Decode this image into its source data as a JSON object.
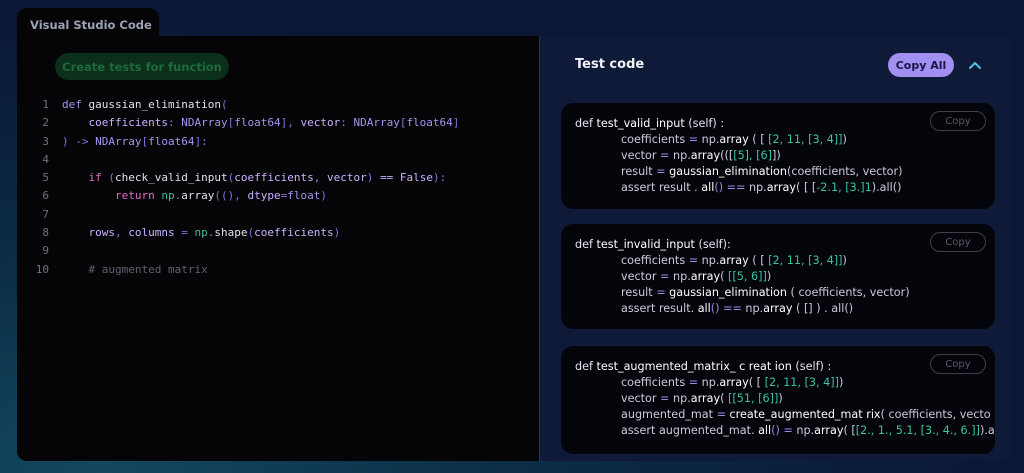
{
  "window": {
    "tab_title": "Visual Studio Code"
  },
  "editor": {
    "create_button_label": "Create tests for function",
    "line_numbers": [
      "1",
      "2",
      "3",
      "4",
      "5",
      "6",
      "7",
      "8",
      "9",
      "10"
    ],
    "code": {
      "l1_def": "def",
      "l1_name": "gaussian_elimination",
      "l1_paren": "(",
      "l2_p1": "coefficients",
      "l2_c1": ":",
      "l2_t1a": "NDArray",
      "l2_b1": "[",
      "l2_t1b": "float64",
      "l2_b2": "],",
      "l2_p2": "vector",
      "l2_c2": ":",
      "l2_t2a": "NDArray",
      "l2_b3": "[",
      "l2_t2b": "float64",
      "l2_b4": "]",
      "l3_close": ") ->",
      "l3_t1": "NDArray",
      "l3_b1": "[",
      "l3_t2": "float64",
      "l3_end": "]:",
      "l5_if": "if",
      "l5_p1": "(",
      "l5_fn": "check_valid_input",
      "l5_p2": "(",
      "l5_a1": "coefficients",
      "l5_comma": ",",
      "l5_a2": "vector",
      "l5_p3": ")",
      "l5_eq": "==",
      "l5_false": "False",
      "l5_end": "):",
      "l6_return": "return",
      "l6_np": "np",
      "l6_dot": ".",
      "l6_array": "array",
      "l6_args": "((), ",
      "l6_dtype": "dtype",
      "l6_eq": "=",
      "l6_float": "float",
      "l6_end": ")",
      "l8_rows": "rows",
      "l8_comma": ",",
      "l8_cols": "columns",
      "l8_eq": "=",
      "l8_np": "np",
      "l8_dot": ".",
      "l8_shape": "shape",
      "l8_p1": "(",
      "l8_arg": "coefficients",
      "l8_p2": ")",
      "l10_comment": "# augmented matrix"
    }
  },
  "panel": {
    "title": "Test code",
    "copy_all_label": "Copy All",
    "collapse_icon": "chevron-up-icon",
    "card_copy_label": "Copy"
  },
  "tests": {
    "t1": {
      "l1_def": "def ",
      "l1_name": "test_valid_input",
      "l1_rest": " (self) :",
      "l2_a": "coefficients",
      "l2_eq": " = ",
      "l2_np": "np.",
      "l2_fn": "array",
      "l2_b": " ( [ ",
      "l2_v1": "[2, 11, [3, 4]]",
      "l2_e": ")",
      "l3_a": "vector",
      "l3_eq": " = ",
      "l3_np": "np.",
      "l3_fn": "array",
      "l3_b": "(([",
      "l3_v1": "[5], [6]",
      "l3_e": "])",
      "l4_a": "result",
      "l4_eq": " = ",
      "l4_fn": "gaussian_elimination",
      "l4_e": "(coefficients, vector)",
      "l5_a": "assert result . ",
      "l5_fn": "all",
      "l5_m": "() == ",
      "l5_np": "np.",
      "l5_fn2": "array",
      "l5_b": "( [ [",
      "l5_v1": "-2.1, [3.]1",
      "l5_e": ").all()"
    },
    "t2": {
      "l1_def": "def ",
      "l1_name": "test_invalid_input",
      "l1_rest": " (self):",
      "l2_a": "coefficients",
      "l2_eq": " = ",
      "l2_np": "np.",
      "l2_fn": "array",
      "l2_b": " ( [ ",
      "l2_v1": "[2, 11, [3, 4]]",
      "l2_e": ")",
      "l3_a": "vector",
      "l3_eq": " = ",
      "l3_np": "np.",
      "l3_fn": "array",
      "l3_b": "( ",
      "l3_v1": "[[5, 6]]",
      "l3_e": ")",
      "l4_a": "result",
      "l4_eq": " = ",
      "l4_fn": "gaussian_elimination",
      "l4_e": " ( coefficients, vector)",
      "l5_a": "assert result. ",
      "l5_fn": "all",
      "l5_m": "() == ",
      "l5_np": "np.",
      "l5_fn2": "array",
      "l5_e": " ( [] ) . all()"
    },
    "t3": {
      "l1_def": "def ",
      "l1_name": "test_augmented_matrix_ c reat ion",
      "l1_rest": " (self) :",
      "l2_a": "coefficients",
      "l2_eq": " = ",
      "l2_np": "np.",
      "l2_fn": "array",
      "l2_b": "( [ ",
      "l2_v1": "[2, 11, [3, 4]]",
      "l2_e": ")",
      "l3_a": "vector",
      "l3_eq": " = ",
      "l3_np": "np.",
      "l3_fn": "array",
      "l3_b": "( ",
      "l3_v1": "[[51, [6]]",
      "l3_e": ")",
      "l4_a": "augmented_mat",
      "l4_eq": " = ",
      "l4_fn": "create_augmented_mat rix",
      "l4_e": "( coefficients, vecto",
      "l5_a": "assert augmented_mat. ",
      "l5_fn": "all",
      "l5_m": "() = ",
      "l5_np": "np.",
      "l5_fn2": "array",
      "l5_b": "( [",
      "l5_v1": "[2., 1., 5.1, [3., 4., 6.]]",
      "l5_e": ").all"
    }
  }
}
